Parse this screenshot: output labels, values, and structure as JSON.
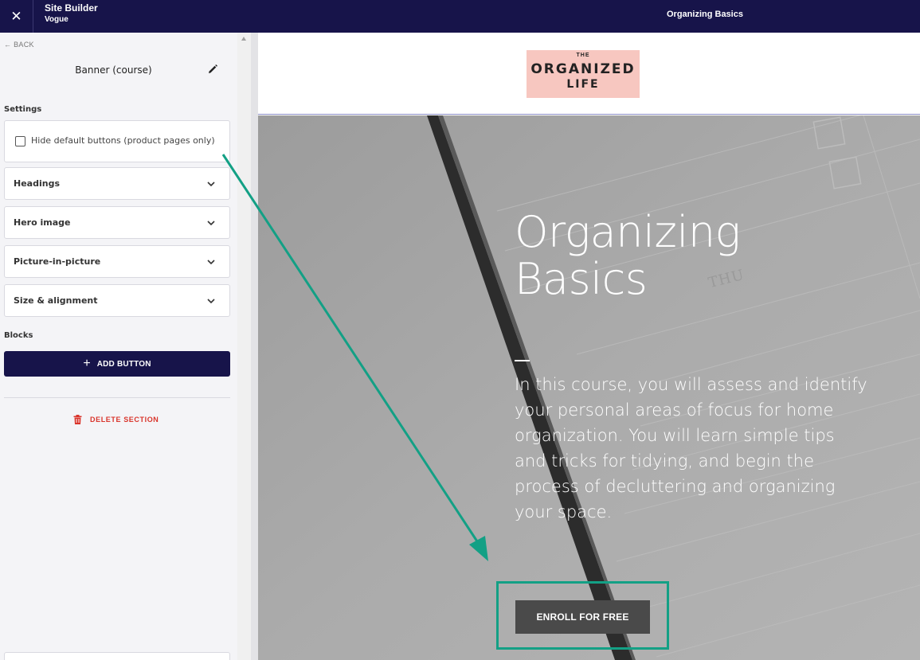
{
  "topbar": {
    "close_icon": "close-icon",
    "app_title": "Site Builder",
    "app_subtitle": "Vogue",
    "page_title": "Organizing Basics",
    "background": "#17144a"
  },
  "panel": {
    "back_label": "← BACK",
    "title": "Banner (course)",
    "settings_label": "Settings",
    "hide_buttons_label": "Hide default buttons (product pages only)",
    "hide_buttons_checked": false,
    "accordions": [
      {
        "label": "Headings"
      },
      {
        "label": "Hero image"
      },
      {
        "label": "Picture-in-picture"
      },
      {
        "label": "Size & alignment"
      }
    ],
    "blocks_label": "Blocks",
    "add_button_label": "ADD BUTTON",
    "delete_label": "DELETE SECTION",
    "delete_color": "#d9342b"
  },
  "preview": {
    "logo": {
      "the": "THE",
      "main": "ORGANIZED",
      "sub": "LIFE",
      "color": "#f7c7c0"
    },
    "hero": {
      "title_line1": "Organizing",
      "title_line2": "Basics",
      "handwritten": "THU",
      "description": "In this course, you will assess and identify your personal areas of focus for home organization. You will learn simple tips and tricks for tidying, and begin the process of decluttering and organizing your space.",
      "enroll_label": "ENROLL FOR FREE",
      "highlight_color": "#13a085"
    }
  }
}
